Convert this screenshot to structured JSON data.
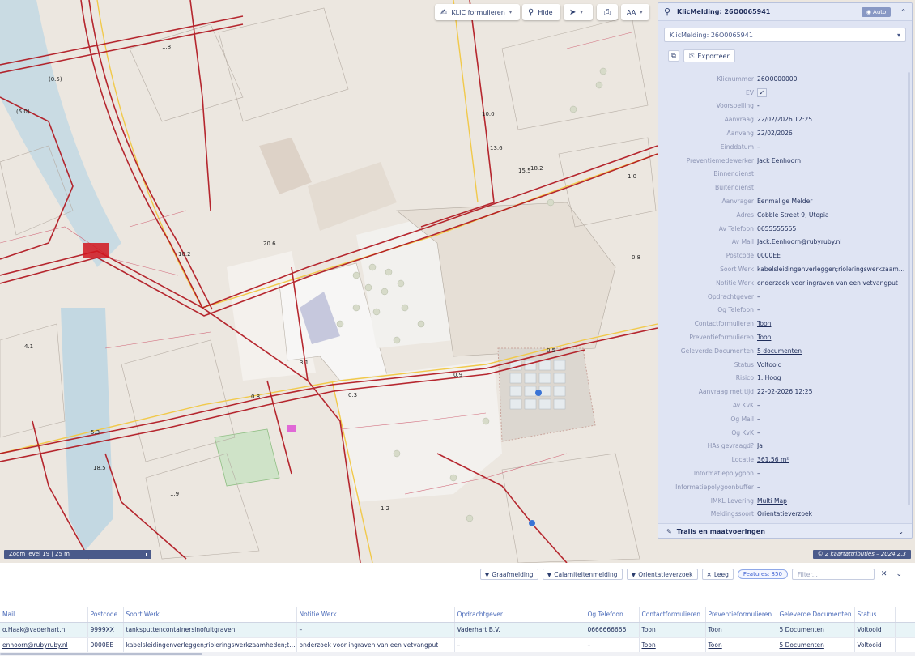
{
  "toolbar": {
    "klic_label": "KLIC formulieren",
    "hide_label": "Hide",
    "text_size_label": "AA"
  },
  "map": {
    "zoom_label": "Zoom level 19 | 25 m",
    "attribution": "© 2 kaartattributies – 2024.2.3"
  },
  "panel": {
    "title": "KlicMelding: 26O0065941",
    "auto_label": "Auto",
    "select_value": "KlicMelding: 26O0065941",
    "export_label": "Exporteer",
    "fields": [
      {
        "key": "Klicnummer",
        "value": "26O0000000"
      },
      {
        "key": "EV",
        "value": "✓",
        "type": "check"
      },
      {
        "key": "Voorspelling",
        "value": "-"
      },
      {
        "key": "Aanvraag",
        "value": "22/02/2026 12:25"
      },
      {
        "key": "Aanvang",
        "value": "22/02/2026"
      },
      {
        "key": "Einddatum",
        "value": "–"
      },
      {
        "key": "Preventiemedewerker",
        "value": "Jack Eenhoorn"
      },
      {
        "key": "Binnendienst",
        "value": ""
      },
      {
        "key": "Buitendienst",
        "value": ""
      },
      {
        "key": "Aanvrager",
        "value": "Eenmalige Melder"
      },
      {
        "key": "Adres",
        "value": "Cobble Street 9, Utopia"
      },
      {
        "key": "Av Telefoon",
        "value": "0655555555"
      },
      {
        "key": "Av Mail",
        "value": "Jack.Eenhoorn@rubyruby.nl",
        "type": "link"
      },
      {
        "key": "Postcode",
        "value": "0000EE"
      },
      {
        "key": "Soort Werk",
        "value": "kabelsleidingenverleggen;rioleringswerkzaamheden"
      },
      {
        "key": "Notitie Werk",
        "value": "onderzoek voor ingraven van een vetvangput"
      },
      {
        "key": "Opdrachtgever",
        "value": "–"
      },
      {
        "key": "Og Telefoon",
        "value": "–"
      },
      {
        "key": "Contactformulieren",
        "value": "Toon",
        "type": "link"
      },
      {
        "key": "Preventieformulieren",
        "value": "Toon",
        "type": "link"
      },
      {
        "key": "Geleverde Documenten",
        "value": "5 documenten",
        "type": "link"
      },
      {
        "key": "Status",
        "value": "Voltooid"
      },
      {
        "key": "Risico",
        "value": "1. Hoog"
      },
      {
        "key": "Aanvraag met tijd",
        "value": "22-02-2026 12:25"
      },
      {
        "key": "Av KvK",
        "value": "–"
      },
      {
        "key": "Og Mail",
        "value": "–"
      },
      {
        "key": "Og KvK",
        "value": "–"
      },
      {
        "key": "HAs gevraagd?",
        "value": "Ja"
      },
      {
        "key": "Locatie",
        "value": "361.56 m²",
        "type": "link"
      },
      {
        "key": "Informatiepolygoon",
        "value": "–"
      },
      {
        "key": "Informatiepolygoonbuffer",
        "value": "–"
      },
      {
        "key": "IMKL Levering",
        "value": "Multi Map",
        "type": "link"
      },
      {
        "key": "Meldingssoort",
        "value": "Orientatieverzoek"
      }
    ],
    "trails_label": "Trails en maatvoeringen"
  },
  "filterbar": {
    "graafmelding": "Graafmelding",
    "calamiteitenmelding": "Calamiteitenmelding",
    "orientatieverzoek": "Orientatieverzoek",
    "leeg": "Leeg",
    "features": "Features: 850",
    "filter_placeholder": "Filter..."
  },
  "table": {
    "columns": [
      "Mail",
      "Postcode",
      "Soort Werk",
      "Notitie Werk",
      "Opdrachtgever",
      "Og Telefoon",
      "Contactformulieren",
      "Preventieformulieren",
      "Geleverde Documenten",
      "Status",
      ""
    ],
    "rows": [
      [
        "o.Haak@vaderhart.nl",
        "9999XX",
        "tanksputtencontainersinofuitgraven",
        "–",
        "Vaderhart B.V.",
        "0666666666",
        "Toon",
        "Toon",
        "5 Documenten",
        "Voltooid",
        ""
      ],
      [
        "enhoorn@rubyruby.nl",
        "0000EE",
        "kabelsleidingenverleggen;rioleringswerkzaamheden;ta...",
        "onderzoek voor ingraven van een vetvangput",
        "–",
        "–",
        "Toon",
        "Toon",
        "5 Documenten",
        "Voltooid",
        ""
      ]
    ]
  }
}
